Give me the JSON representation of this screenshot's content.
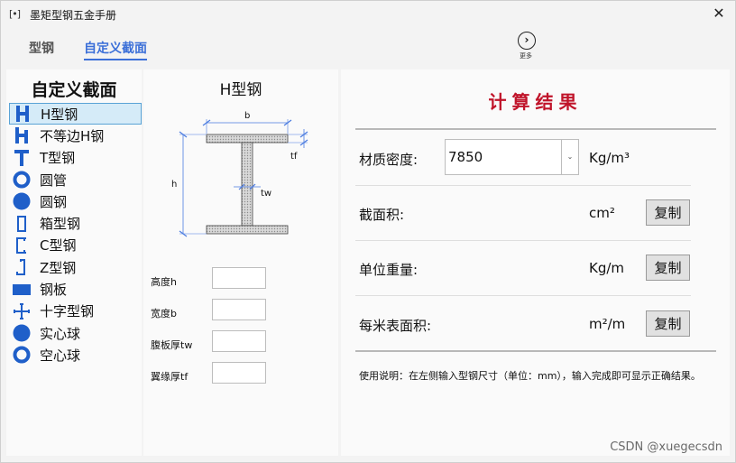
{
  "window": {
    "title": "墨矩型钢五金手册",
    "app_icon": "[•]",
    "close_glyph": "✕"
  },
  "tabs": [
    {
      "label": "型钢",
      "active": false
    },
    {
      "label": "自定义截面",
      "active": true
    }
  ],
  "more": {
    "label": "更多",
    "icon": "chevron-right-circle-icon",
    "glyph": "›"
  },
  "sidebar": {
    "title": "自定义截面",
    "items": [
      {
        "label": "H型钢",
        "icon": "h-beam-icon",
        "selected": true
      },
      {
        "label": "不等边H钢",
        "icon": "unequal-h-beam-icon",
        "selected": false
      },
      {
        "label": "T型钢",
        "icon": "t-beam-icon",
        "selected": false
      },
      {
        "label": "圆管",
        "icon": "round-tube-icon",
        "selected": false
      },
      {
        "label": "圆钢",
        "icon": "round-bar-icon",
        "selected": false
      },
      {
        "label": "箱型钢",
        "icon": "box-section-icon",
        "selected": false
      },
      {
        "label": "C型钢",
        "icon": "c-channel-icon",
        "selected": false
      },
      {
        "label": "Z型钢",
        "icon": "z-section-icon",
        "selected": false
      },
      {
        "label": "钢板",
        "icon": "steel-plate-icon",
        "selected": false
      },
      {
        "label": "十字型钢",
        "icon": "cross-section-icon",
        "selected": false
      },
      {
        "label": "实心球",
        "icon": "solid-sphere-icon",
        "selected": false
      },
      {
        "label": "空心球",
        "icon": "hollow-sphere-icon",
        "selected": false
      }
    ]
  },
  "section": {
    "title": "H型钢",
    "diagram_labels": {
      "b": "b",
      "h": "h",
      "tf": "tf",
      "tw": "tw"
    },
    "fields": [
      {
        "label": "高度h",
        "value": ""
      },
      {
        "label": "宽度b",
        "value": ""
      },
      {
        "label": "腹板厚tw",
        "value": ""
      },
      {
        "label": "翼缘厚tf",
        "value": ""
      }
    ]
  },
  "results": {
    "title": "计算结果",
    "density": {
      "label": "材质密度:",
      "value": "7850",
      "unit": "Kg/m³",
      "arrow": "⌄"
    },
    "rows": [
      {
        "label": "截面积:",
        "unit": "cm²",
        "copy_label": "复制"
      },
      {
        "label": "单位重量:",
        "unit": "Kg/m",
        "copy_label": "复制"
      },
      {
        "label": "每米表面积:",
        "unit": "m²/m",
        "copy_label": "复制"
      }
    ],
    "instructions": "使用说明：在左侧输入型钢尺寸（单位：mm），输入完成即可显示正确结果。"
  },
  "watermark": "CSDN @xuegecsdn",
  "colors": {
    "accent": "#3b6fd8",
    "icon_blue": "#1f5fc9",
    "result_title": "#c0142a",
    "selected_bg": "#d5ebf8",
    "dim_line": "#4a7be0"
  }
}
